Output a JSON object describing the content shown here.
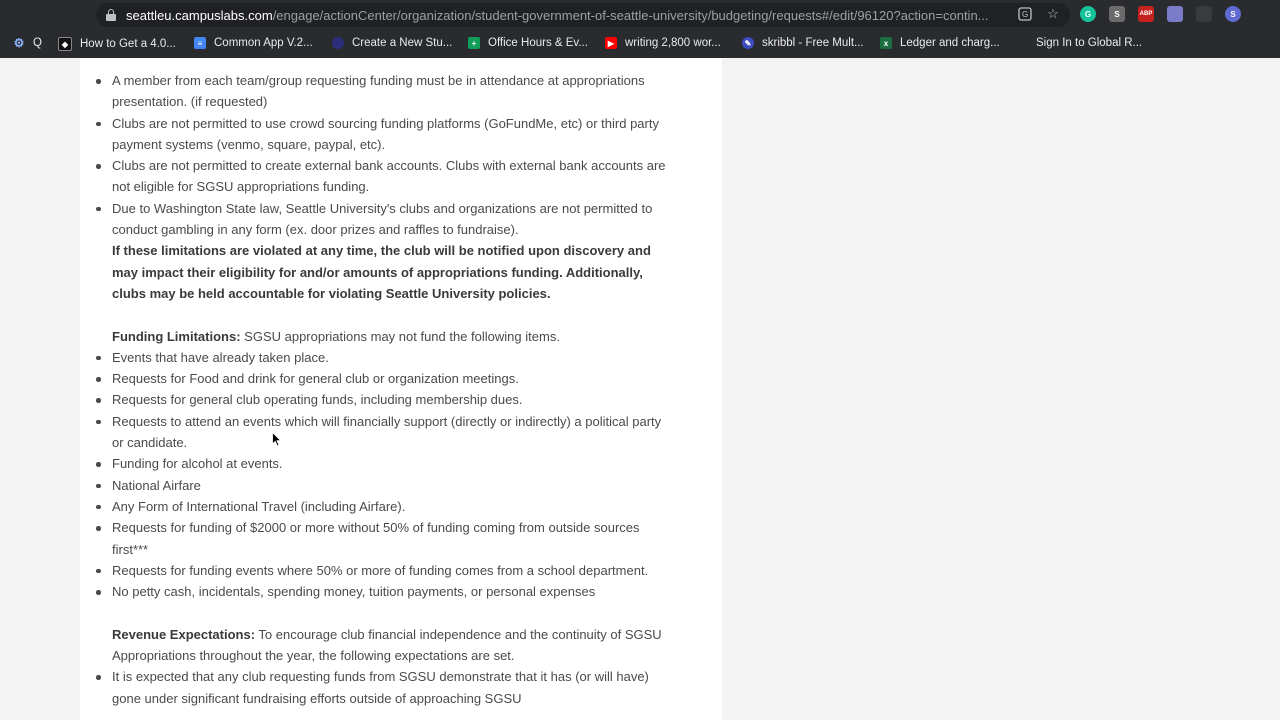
{
  "browser": {
    "url_domain": "seattleu.campuslabs.com",
    "url_path": "/engage/actionCenter/organization/student-government-of-seattle-university/budgeting/requests#/edit/96120?action=contin...",
    "bookmarks": [
      {
        "label": "Q",
        "icon": "gear-icon"
      },
      {
        "label": "How to Get a 4.0...",
        "icon": "shield-icon"
      },
      {
        "label": "Common App V.2...",
        "icon": "docs-icon"
      },
      {
        "label": "Create a New Stu...",
        "icon": "circle-icon"
      },
      {
        "label": "Office Hours & Ev...",
        "icon": "sheets-icon"
      },
      {
        "label": "writing 2,800 wor...",
        "icon": "youtube-icon"
      },
      {
        "label": "skribbl - Free Mult...",
        "icon": "pencil-icon"
      },
      {
        "label": "Ledger and charg...",
        "icon": "excel-icon"
      },
      {
        "label": "Sign In to Global R...",
        "icon": ""
      }
    ],
    "extensions": [
      "G",
      "S",
      "ABP",
      "",
      "S"
    ]
  },
  "content": {
    "limits_items": [
      "A member from each team/group requesting funding must be in attendance at appropriations presentation. (if requested)",
      "Clubs are not permitted to use crowd sourcing funding platforms (GoFundMe, etc) or third party payment systems (venmo, square, paypal, etc).",
      "Clubs are not permitted to create external bank accounts. Clubs with external bank accounts are not eligible for SGSU appropriations funding.",
      "Due to Washington State law, Seattle University's clubs and organizations are not permitted to conduct gambling in any form (ex. door prizes and raffles to fundraise)."
    ],
    "violation_warning": "If these limitations are violated at any time, the club will be notified upon discovery and may impact their eligibility for and/or amounts of appropriations funding. Additionally, clubs may be held accountable for violating Seattle University policies.",
    "funding_limitations_heading": "Funding Limitations:",
    "funding_limitations_intro": " SGSU appropriations may not fund the following items.",
    "funding_items": [
      "Events that have already taken place.",
      "Requests for Food and drink for general club or organization meetings.",
      "Requests for general club operating funds, including membership dues.",
      "Requests to attend an events which will financially support (directly or indirectly) a political party or candidate.",
      "Funding for alcohol at events.",
      "National Airfare",
      "Any Form of International Travel (including Airfare).",
      "Requests for funding of $2000 or more without 50% of funding coming from outside sources first***",
      "Requests for funding events where 50% or more of funding comes from a school department.",
      "No petty cash, incidentals, spending money, tuition payments, or personal expenses"
    ],
    "revenue_heading": "Revenue Expectations:",
    "revenue_intro": " To encourage club financial independence and the continuity of SGSU Appropriations throughout the year, the following expectations are set.",
    "revenue_items": [
      "It is expected that any club requesting funds from SGSU demonstrate that it has (or will have) gone under significant fundraising efforts outside of approaching SGSU"
    ]
  }
}
